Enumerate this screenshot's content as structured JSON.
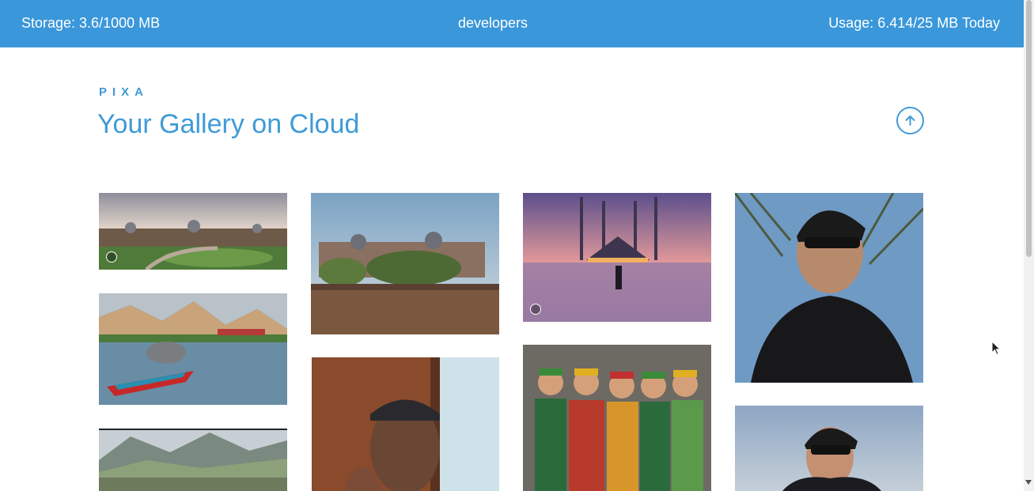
{
  "header": {
    "storage": "Storage: 3.6/1000 MB",
    "user": "developers",
    "usage": "Usage: 6.414/25 MB Today"
  },
  "main": {
    "brand": "PIXA",
    "title": "Your Gallery on Cloud"
  },
  "gallery": {
    "photos": [
      {
        "name": "campus-panorama"
      },
      {
        "name": "lake-boat"
      },
      {
        "name": "valley-town"
      },
      {
        "name": "campus-building"
      },
      {
        "name": "selfie-cap"
      },
      {
        "name": "mosque-sunset"
      },
      {
        "name": "children-traditional-dress"
      },
      {
        "name": "portrait-sunglasses-tree"
      },
      {
        "name": "portrait-sunglasses-sky"
      }
    ]
  },
  "colors": {
    "topbar": "#3a97da",
    "accent": "#3f9bd6"
  },
  "icons": {
    "upload": "arrow-up-circle-icon",
    "lens": "lens-icon"
  }
}
